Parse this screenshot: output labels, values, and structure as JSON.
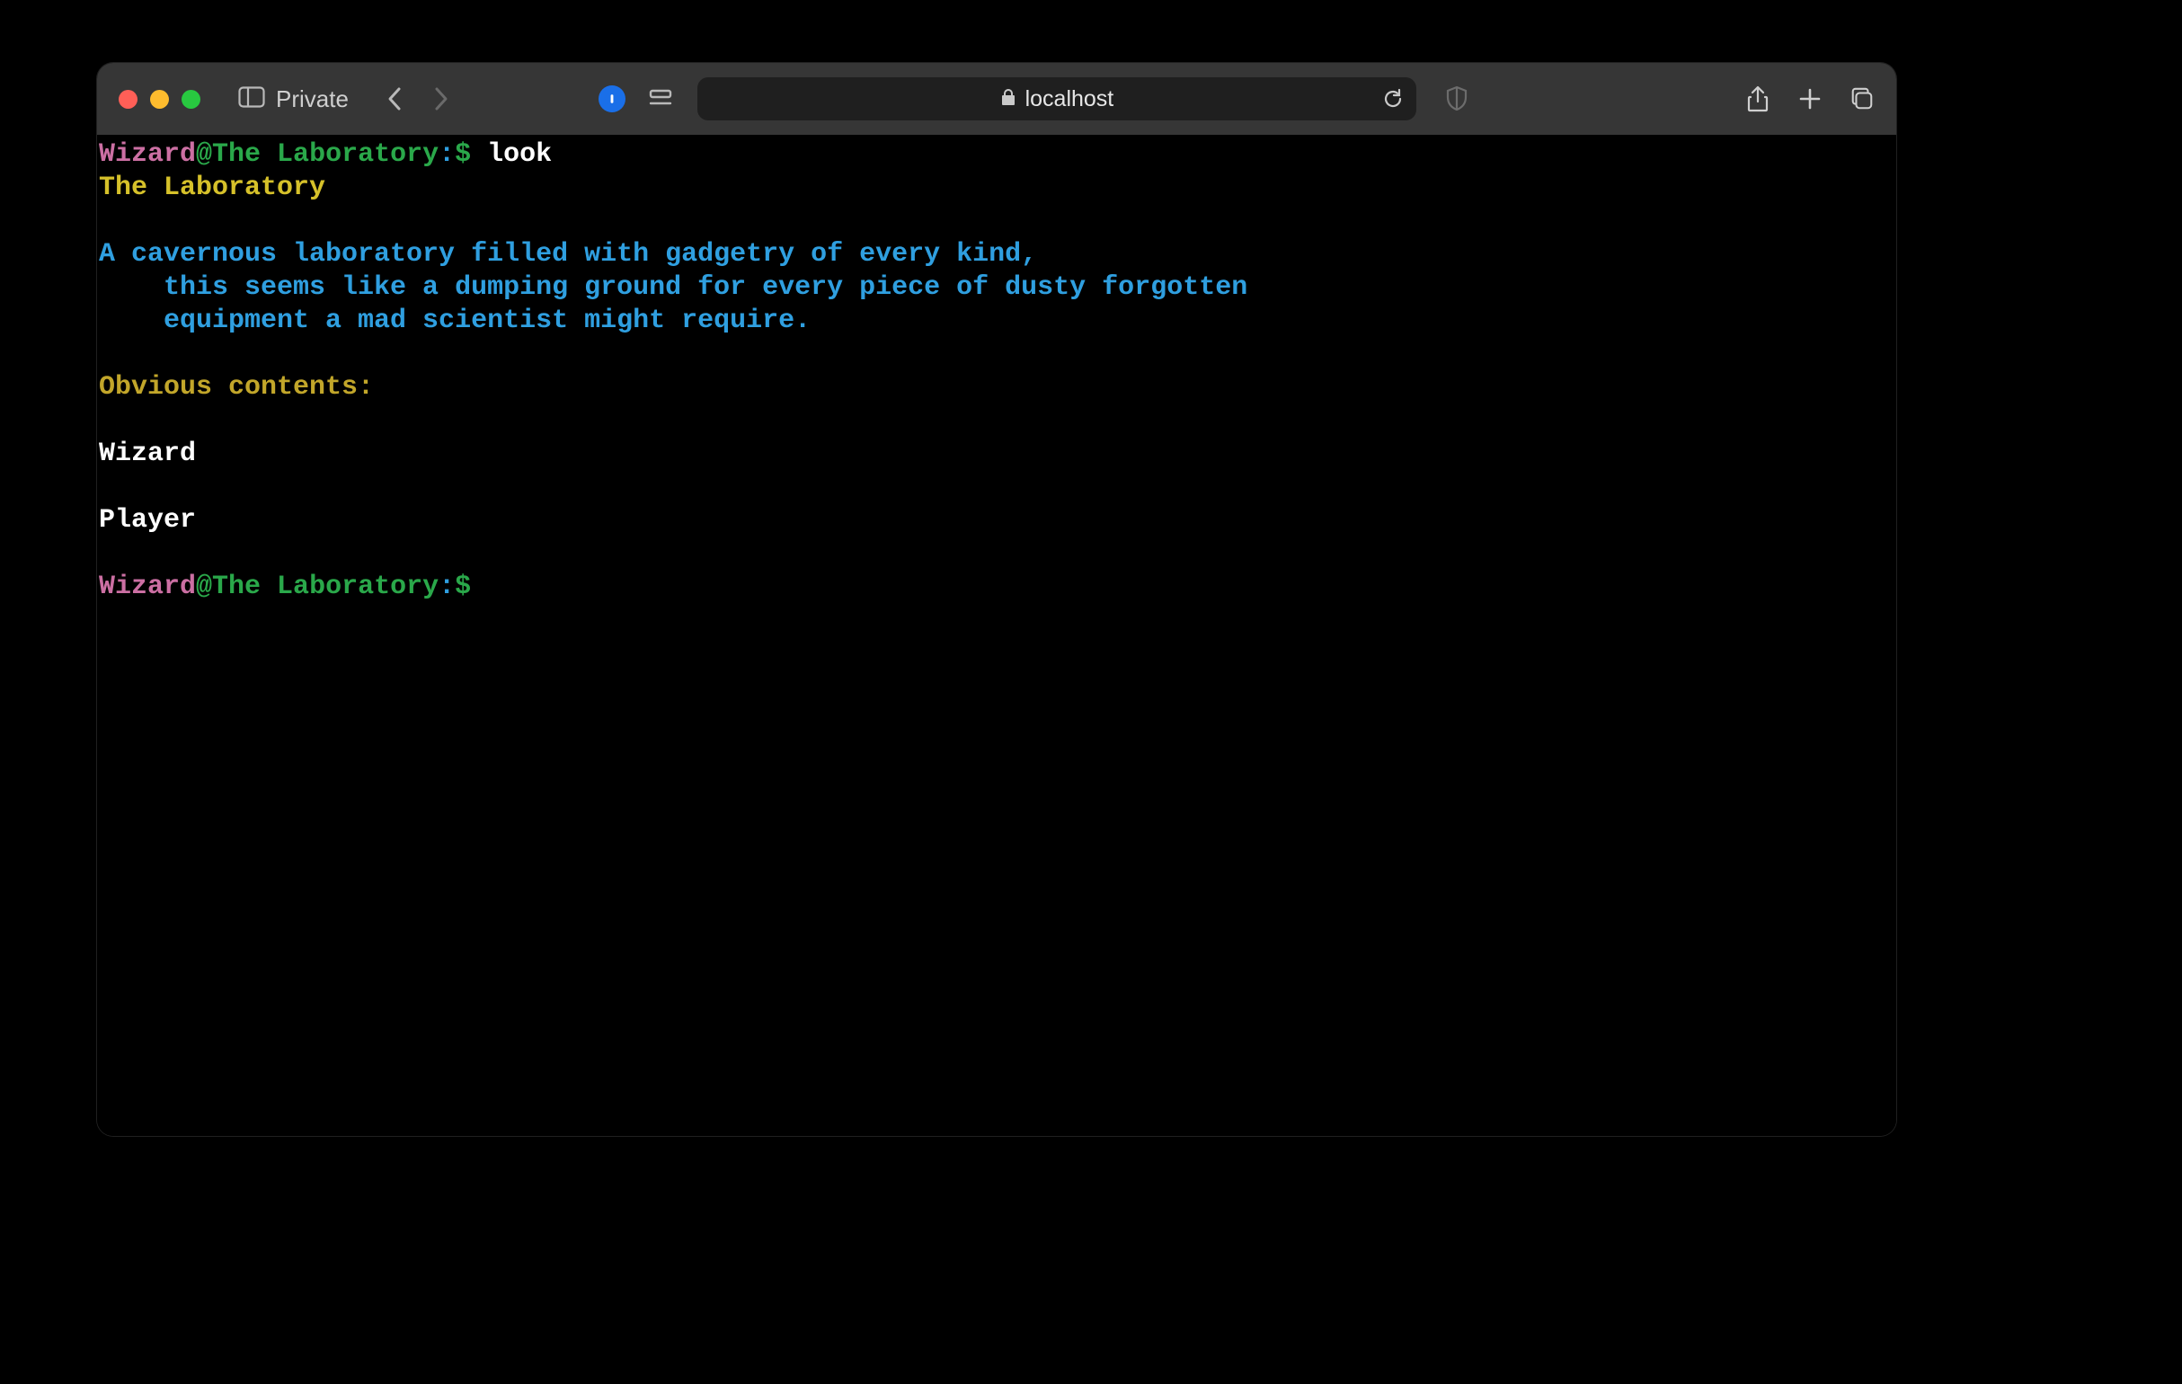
{
  "browser": {
    "private_label": "Private",
    "address": "localhost"
  },
  "terminal": {
    "prompt1": {
      "user": "Wizard",
      "at": "@",
      "location": "The Laboratory",
      "colon": ":",
      "dollar": "$",
      "command": " look"
    },
    "room_title": "The Laboratory",
    "blank1": " ",
    "desc_line1": "A cavernous laboratory filled with gadgetry of every kind,",
    "desc_line2": "    this seems like a dumping ground for every piece of dusty forgotten",
    "desc_line3": "    equipment a mad scientist might require.",
    "blank2": " ",
    "obvious_label": "Obvious contents:",
    "blank3": " ",
    "content1": "Wizard",
    "blank4": " ",
    "content2": "Player",
    "blank5": " ",
    "prompt2": {
      "user": "Wizard",
      "at": "@",
      "location": "The Laboratory",
      "colon": ":",
      "dollar": "$",
      "command": ""
    }
  }
}
